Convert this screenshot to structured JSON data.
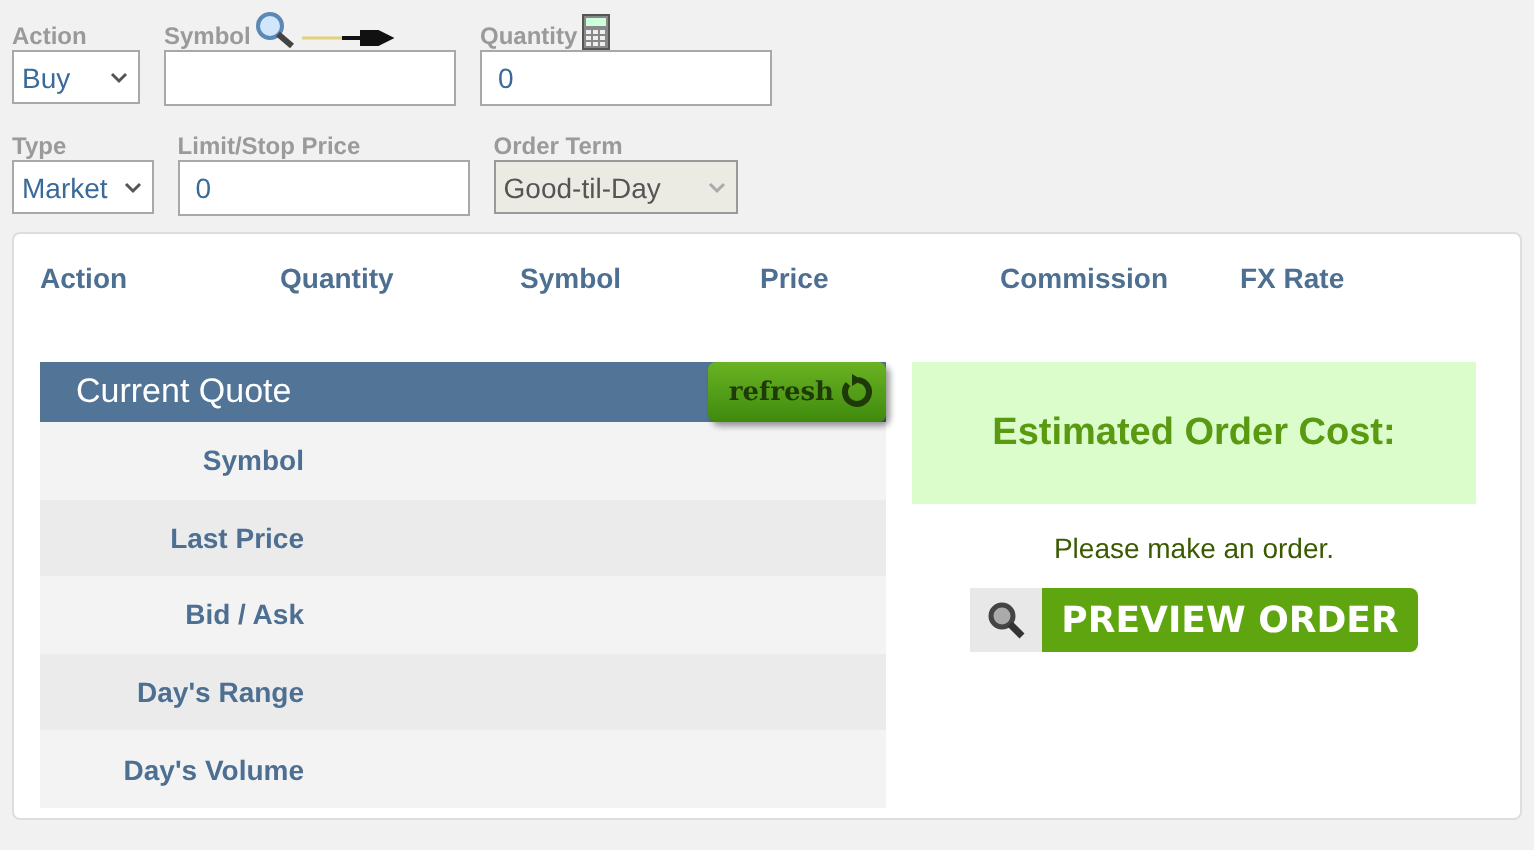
{
  "order_form": {
    "row_1": [
      {
        "kind": "select",
        "label": "Action",
        "value": "Buy",
        "disabled": false
      },
      {
        "kind": "text",
        "label": "Symbol"
      },
      {
        "kind": "text",
        "label": "Quantity",
        "value": "0"
      }
    ],
    "row_2": [
      {
        "kind": "select",
        "label": "Type",
        "value": "Market",
        "disabled": false
      },
      {
        "kind": "text",
        "label": "Limit/Stop Price",
        "value": "0"
      },
      {
        "kind": "select",
        "label": "Order Term",
        "value": "Good-til-Day",
        "disabled": true
      }
    ]
  },
  "order_table": {
    "columns": [
      "Action",
      "Quantity",
      "Symbol",
      "Price",
      "Commission",
      "FX Rate"
    ]
  },
  "current_quote": {
    "title": "Current Quote",
    "refresh_button": "refresh",
    "rows": [
      "Symbol",
      "Last Price",
      "Bid / Ask",
      "Day's Range",
      "Day's Volume"
    ]
  },
  "estimate": {
    "title": "Estimated Order Cost:",
    "message": "Please make an order.",
    "preview_button": "PREVIEW ORDER"
  }
}
